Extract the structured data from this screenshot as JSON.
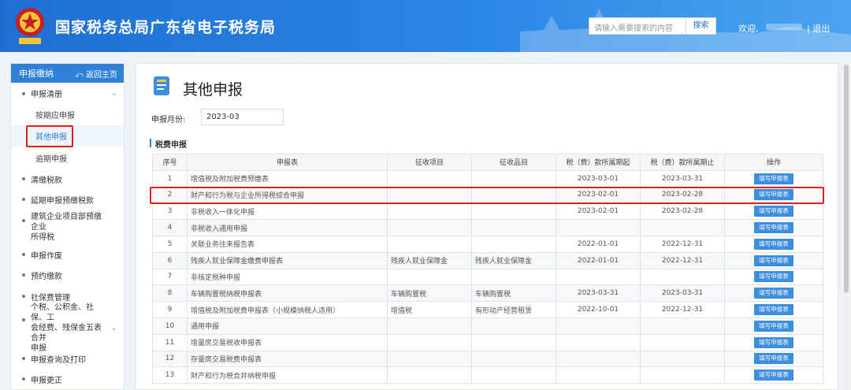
{
  "header": {
    "site_title": "国家税务总局广东省电子税务局",
    "search_placeholder": "请输入需要搜索的内容",
    "search_button": "搜索",
    "welcome": "欢迎,",
    "user_suffix": ".",
    "logout": "| 退出",
    "colors": {
      "bar_start": "#1f6fd1",
      "bar_end": "#4aa3f0"
    }
  },
  "sidebar": {
    "head": "申报缴纳",
    "back": "返回主页",
    "groups": [
      {
        "label": "申报清册",
        "expandable": true,
        "children": [
          "按期应申报",
          "其他申报",
          "逾期申报"
        ],
        "active_child": 1
      },
      {
        "label": "清缴税款"
      },
      {
        "label": "延期申报预缴税款"
      },
      {
        "label_lines": [
          "建筑企业项目部预缴企业",
          "所得税"
        ]
      },
      {
        "label": "申报作废"
      },
      {
        "label": "预约缴款"
      },
      {
        "label": "社保费管理"
      },
      {
        "label_lines": [
          "个税、公积金、社保、工",
          "会经费、残保金五表合并",
          "申报"
        ],
        "expandable": true
      },
      {
        "label": "申报查询及打印"
      },
      {
        "label": "申报更正"
      }
    ]
  },
  "main": {
    "title": "其他申报",
    "month_label": "申报月份:",
    "month_value": "2023-03",
    "section_title": "税费申报",
    "columns": [
      "序号",
      "申报表",
      "征收项目",
      "征收品目",
      "税（费）款所属期起",
      "税（费）款所属期止",
      "操作"
    ],
    "action_label": "填写申报表",
    "rows": [
      [
        "1",
        "增值税及附加税费预缴表",
        "",
        "",
        "2023-03-01",
        "2023-03-31"
      ],
      [
        "2",
        "财产和行为税与企业所得税综合申报",
        "",
        "",
        "2023-02-01",
        "2023-02-28"
      ],
      [
        "3",
        "非税收入一体化申报",
        "",
        "",
        "2023-02-01",
        "2023-02-28"
      ],
      [
        "4",
        "非税收入通用申报",
        "",
        "",
        "",
        ""
      ],
      [
        "5",
        "关联业务往来报告表",
        "",
        "",
        "2022-01-01",
        "2022-12-31"
      ],
      [
        "6",
        "残疾人就业保障金缴费申报表",
        "残疾人就业保障金",
        "残疾人就业保障金",
        "2022-01-01",
        "2022-12-31"
      ],
      [
        "7",
        "非核定税种申报",
        "",
        "",
        "",
        ""
      ],
      [
        "8",
        "车辆购置税纳税申报表",
        "车辆购置税",
        "车辆购置税",
        "2023-03-31",
        "2023-03-31"
      ],
      [
        "9",
        "增值税及附加税费申报表（小规模纳税人适用）",
        "增值税",
        "有形动产经营租赁",
        "2022-10-01",
        "2022-12-31"
      ],
      [
        "10",
        "通用申报",
        "",
        "",
        "",
        ""
      ],
      [
        "11",
        "增量房交易税收申报表",
        "",
        "",
        "",
        ""
      ],
      [
        "12",
        "存量房交易税费申报表",
        "",
        "",
        "",
        ""
      ],
      [
        "13",
        "财产和行为税合并纳税申报",
        "",
        "",
        "",
        ""
      ]
    ],
    "highlighted_row": 2
  }
}
